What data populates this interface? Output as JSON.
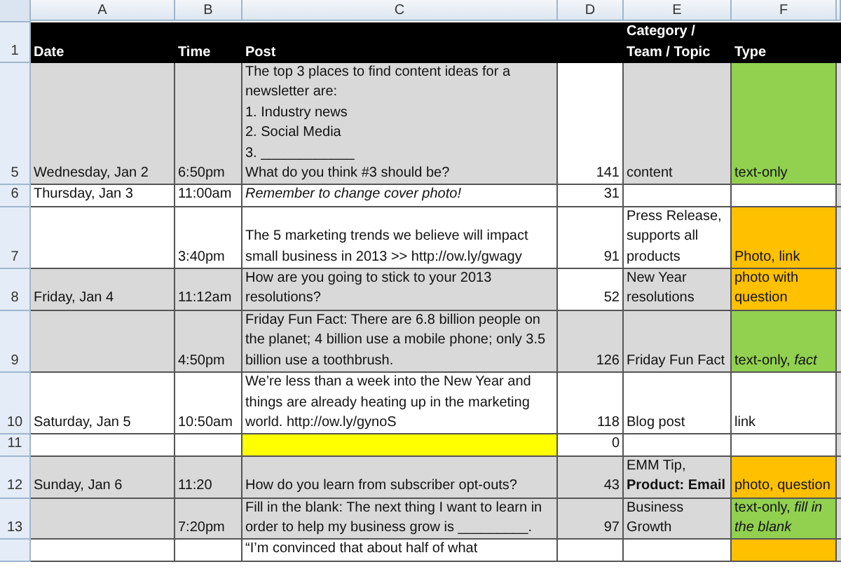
{
  "columns": [
    "A",
    "B",
    "C",
    "D",
    "E",
    "F"
  ],
  "header_row": {
    "number": "1",
    "date": "Date",
    "time": "Time",
    "post": "Post",
    "category": "Category / Team / Topic",
    "type": "Type"
  },
  "rows": [
    {
      "number": "5",
      "shaded": true,
      "count_shaded": false,
      "date": "Wednesday, Jan 2",
      "time": "6:50pm",
      "post": "The top 3 places to find content ideas for a\nnewsletter are:\n1. Industry news\n2. Social Media\n3. ____________\nWhat do you think #3 should be?",
      "count": "141",
      "category": "content",
      "type": {
        "text": "text-only",
        "color": "#92d050"
      }
    },
    {
      "number": "6",
      "shaded": false,
      "count_shaded": false,
      "date": "Thursday, Jan 3",
      "time": "11:00am",
      "post": "Remember to change cover photo!",
      "post_italic": true,
      "count": "31"
    },
    {
      "number": "7",
      "shaded": false,
      "count_shaded": false,
      "time": "3:40pm",
      "post": "The 5 marketing trends we believe will impact small business in 2013 >> http://ow.ly/gwagy",
      "count": "91",
      "category": "Press Release, supports all products",
      "type": {
        "text": "Photo, link",
        "color": "#ffc000"
      }
    },
    {
      "number": "8",
      "shaded": true,
      "count_shaded": false,
      "date": "Friday, Jan 4",
      "time": "11:12am",
      "post": "How are you going to stick to your 2013 resolutions?",
      "count": "52",
      "category": "New Year resolutions",
      "type": {
        "text": "photo with question",
        "color": "#ffc000"
      }
    },
    {
      "number": "9",
      "shaded": true,
      "count_shaded": true,
      "time": "4:50pm",
      "post": "Friday Fun Fact: There are 6.8 billion people on the planet; 4 billion use a mobile phone; only 3.5 billion use a toothbrush.",
      "count": "126",
      "category": "Friday Fun Fact",
      "type": {
        "text": "text-only, *fact*",
        "color": "#92d050"
      }
    },
    {
      "number": "10",
      "shaded": false,
      "count_shaded": false,
      "date": "Saturday, Jan 5",
      "time": "10:50am",
      "post": "We’re less than a week into the New Year and things are already heating up in the marketing world. http://ow.ly/gynoS",
      "count": "118",
      "category": "Blog post",
      "type": {
        "text": "link"
      }
    },
    {
      "number": "11",
      "shaded": false,
      "count_shaded": false,
      "post_highlight": true,
      "count": "0"
    },
    {
      "number": "12",
      "shaded": true,
      "count_shaded": true,
      "date": "Sunday, Jan 6",
      "time": "11:20",
      "post": "How do you learn from subscriber opt-outs?",
      "count": "43",
      "category": "EMM Tip, **Product: Email**",
      "type": {
        "text": "photo, question",
        "color": "#ffc000"
      }
    },
    {
      "number": "13",
      "shaded": true,
      "count_shaded": true,
      "time": "7:20pm",
      "post": "Fill in the blank: The next thing I want to learn in order to help my business grow is _________.",
      "count": "97",
      "category": "Business Growth",
      "type": {
        "text": "text-only, *fill in the blank*",
        "color": "#92d050"
      }
    },
    {
      "shaded": false,
      "count_shaded": false,
      "post": "“I’m convinced that about half of what",
      "type": {
        "color": "#ffc000"
      }
    }
  ]
}
